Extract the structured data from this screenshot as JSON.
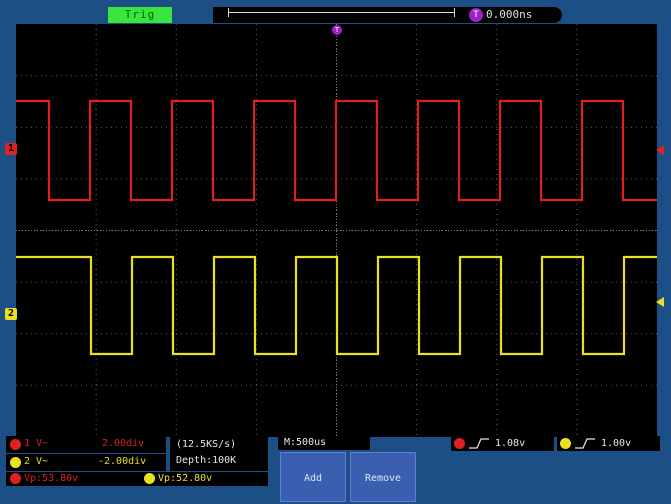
{
  "top": {
    "trigger_state": "Trig",
    "trigger_offset_icon": "T",
    "time_offset": "0.000ns",
    "trigger_pos_icon": "T"
  },
  "channels": {
    "ch1_label": "1",
    "ch2_label": "2",
    "ch1_color": "#e02020",
    "ch2_color": "#e8e020"
  },
  "status": {
    "ch1_scale_left": "1 V~",
    "ch1_scale_right": "2.00div",
    "ch2_scale_left": "2 V~",
    "ch2_scale_right": "-2.00div",
    "ch1_measure": "Vp:53.80v",
    "ch2_measure": "Vp:52.80v",
    "sample_rate": "(12.5KS/s)",
    "depth": "Depth:100K",
    "horizontal": "M:500us",
    "ch1_trigger_level": "1.08v",
    "ch2_trigger_level": "1.00v"
  },
  "buttons": {
    "add": "Add",
    "remove": "Remove"
  },
  "icons": {
    "edge": "rising-edge-icon"
  }
}
